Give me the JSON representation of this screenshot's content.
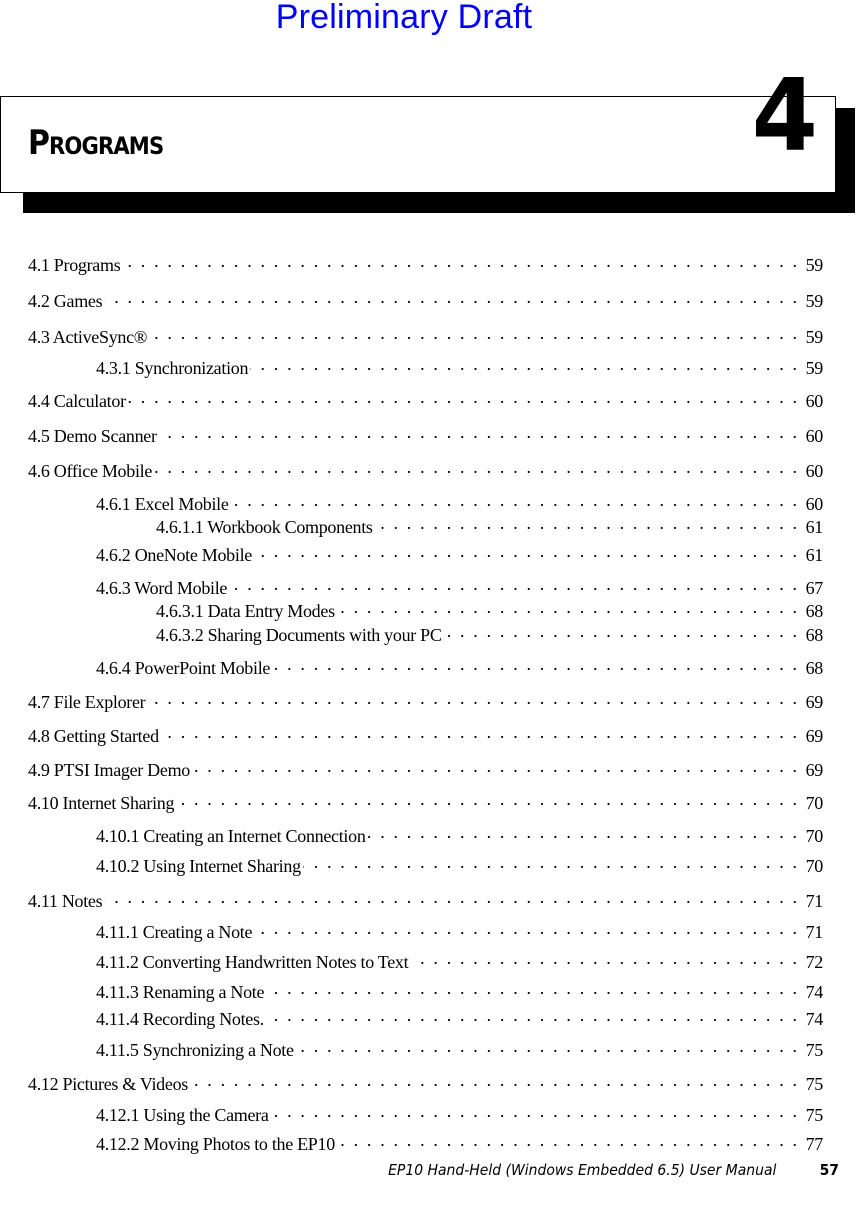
{
  "watermark": "Preliminary Draft",
  "chapter": {
    "title": "Programs",
    "number": "4"
  },
  "toc": [
    {
      "level": 1,
      "label": "4.1 Programs",
      "page": "59"
    },
    {
      "level": 1,
      "label": "4.2 Games",
      "page": "59"
    },
    {
      "level": 1,
      "label": "4.3 ActiveSync®",
      "page": "59"
    },
    {
      "level": 2,
      "label": "4.3.1 Synchronization",
      "page": "59"
    },
    {
      "level": 1,
      "label": "4.4 Calculator",
      "page": "60"
    },
    {
      "level": 1,
      "label": "4.5 Demo Scanner",
      "page": "60"
    },
    {
      "level": 1,
      "label": "4.6 Office Mobile",
      "page": "60"
    },
    {
      "level": 2,
      "label": "4.6.1 Excel Mobile",
      "page": "60"
    },
    {
      "level": 3,
      "label": "4.6.1.1 Workbook Components",
      "page": "61"
    },
    {
      "level": 2,
      "label": "4.6.2 OneNote Mobile",
      "page": "61"
    },
    {
      "level": 2,
      "label": "4.6.3 Word Mobile",
      "page": "67"
    },
    {
      "level": 3,
      "label": "4.6.3.1 Data Entry Modes",
      "page": "68"
    },
    {
      "level": 3,
      "label": "4.6.3.2 Sharing Documents with your PC",
      "page": "68"
    },
    {
      "level": 2,
      "label": "4.6.4 PowerPoint Mobile",
      "page": "68"
    },
    {
      "level": 1,
      "label": "4.7 File Explorer",
      "page": "69"
    },
    {
      "level": 1,
      "label": "4.8 Getting Started",
      "page": "69"
    },
    {
      "level": 1,
      "label": "4.9 PTSI Imager Demo",
      "page": "69"
    },
    {
      "level": 1,
      "label": "4.10 Internet Sharing",
      "page": "70"
    },
    {
      "level": 2,
      "label": "4.10.1 Creating an Internet Connection",
      "page": "70"
    },
    {
      "level": 2,
      "label": "4.10.2 Using Internet Sharing",
      "page": "70"
    },
    {
      "level": 1,
      "label": "4.11 Notes",
      "page": "71"
    },
    {
      "level": 2,
      "label": "4.11.1 Creating a Note",
      "page": "71"
    },
    {
      "level": 2,
      "label": "4.11.2 Converting Handwritten Notes to Text",
      "page": "72"
    },
    {
      "level": 2,
      "label": "4.11.3 Renaming a Note",
      "page": "74"
    },
    {
      "level": 2,
      "label": "4.11.4 Recording Notes.",
      "page": "74"
    },
    {
      "level": 2,
      "label": "4.11.5 Synchronizing a Note",
      "page": "75"
    },
    {
      "level": 1,
      "label": "4.12 Pictures & Videos",
      "page": "75"
    },
    {
      "level": 2,
      "label": "4.12.1 Using the Camera",
      "page": "75"
    },
    {
      "level": 2,
      "label": "4.12.2 Moving Photos to the EP10",
      "page": "77"
    }
  ],
  "footer": {
    "manual_title": "EP10 Hand-Held (Windows Embedded 6.5) User Manual",
    "page_number": "57"
  }
}
